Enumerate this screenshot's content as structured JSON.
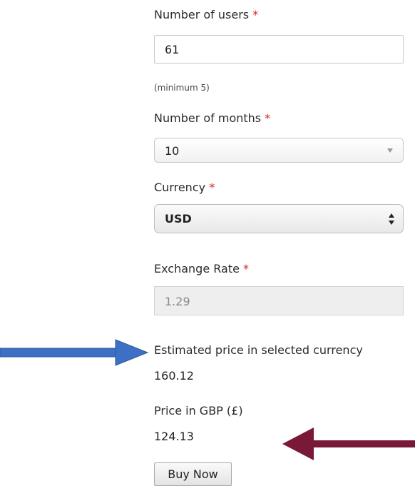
{
  "users": {
    "label": "Number of users",
    "required_mark": "*",
    "value": "61",
    "hint": "(minimum 5)"
  },
  "months": {
    "label": "Number of months",
    "required_mark": "*",
    "selected": "10"
  },
  "currency": {
    "label": "Currency",
    "required_mark": "*",
    "selected": "USD"
  },
  "exchange_rate": {
    "label": "Exchange Rate",
    "required_mark": "*",
    "value": "1.29"
  },
  "estimated_price": {
    "label": "Estimated price in selected currency",
    "value": "160.12"
  },
  "gbp_price": {
    "label": "Price in GBP (£)",
    "value": "124.13"
  },
  "buy_button": {
    "label": "Buy Now"
  },
  "colors": {
    "required": "#d32222",
    "blue_arrow": "#3d6fc4",
    "maroon_arrow": "#7a1838"
  }
}
